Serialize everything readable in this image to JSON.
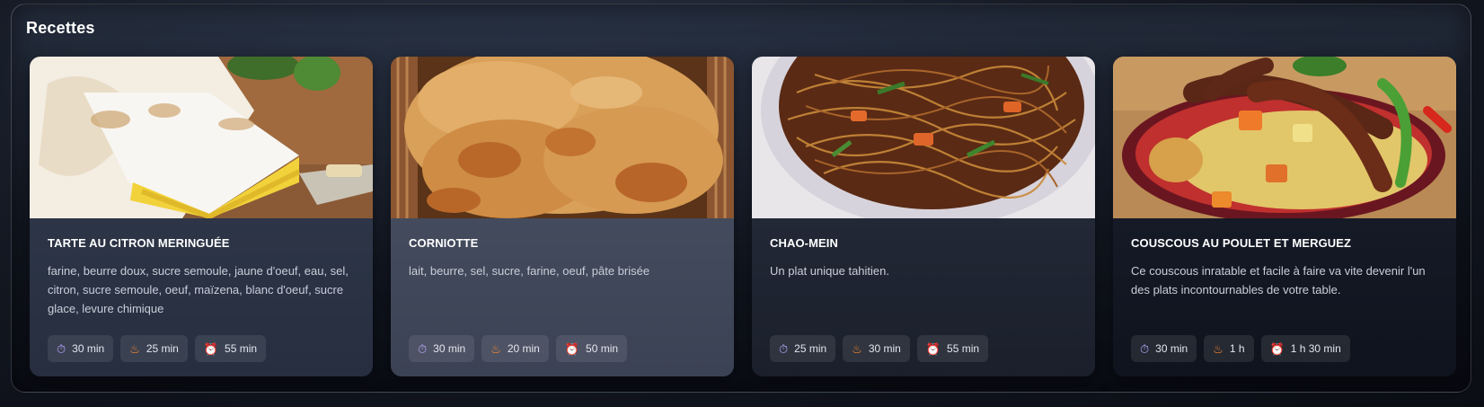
{
  "section": {
    "title": "Recettes"
  },
  "recipes": [
    {
      "title": "TARTE AU CITRON MERINGUÉE",
      "description": "farine, beurre doux, sucre semoule, jaune d'oeuf, eau, sel, citron, sucre semoule, oeuf, maïzena, blanc d'oeuf, sucre glace, levure chimique",
      "prep": "30 min",
      "cook": "25 min",
      "total": "55 min"
    },
    {
      "title": "CORNIOTTE",
      "description": "lait, beurre, sel, sucre, farine, oeuf, pâte brisée",
      "prep": "30 min",
      "cook": "20 min",
      "total": "50 min"
    },
    {
      "title": "CHAO-MEIN",
      "description": "Un plat unique tahitien.",
      "prep": "25 min",
      "cook": "30 min",
      "total": "55 min"
    },
    {
      "title": "COUSCOUS AU POULET ET MERGUEZ",
      "description": "Ce couscous inratable et facile à faire va vite devenir l'un des plats incontournables de votre table.",
      "prep": "30 min",
      "cook": "1 h",
      "total": "1 h 30 min"
    }
  ],
  "icons": {
    "prep": "stopwatch-icon",
    "cook": "flame-icon",
    "total": "alarm-clock-icon"
  }
}
